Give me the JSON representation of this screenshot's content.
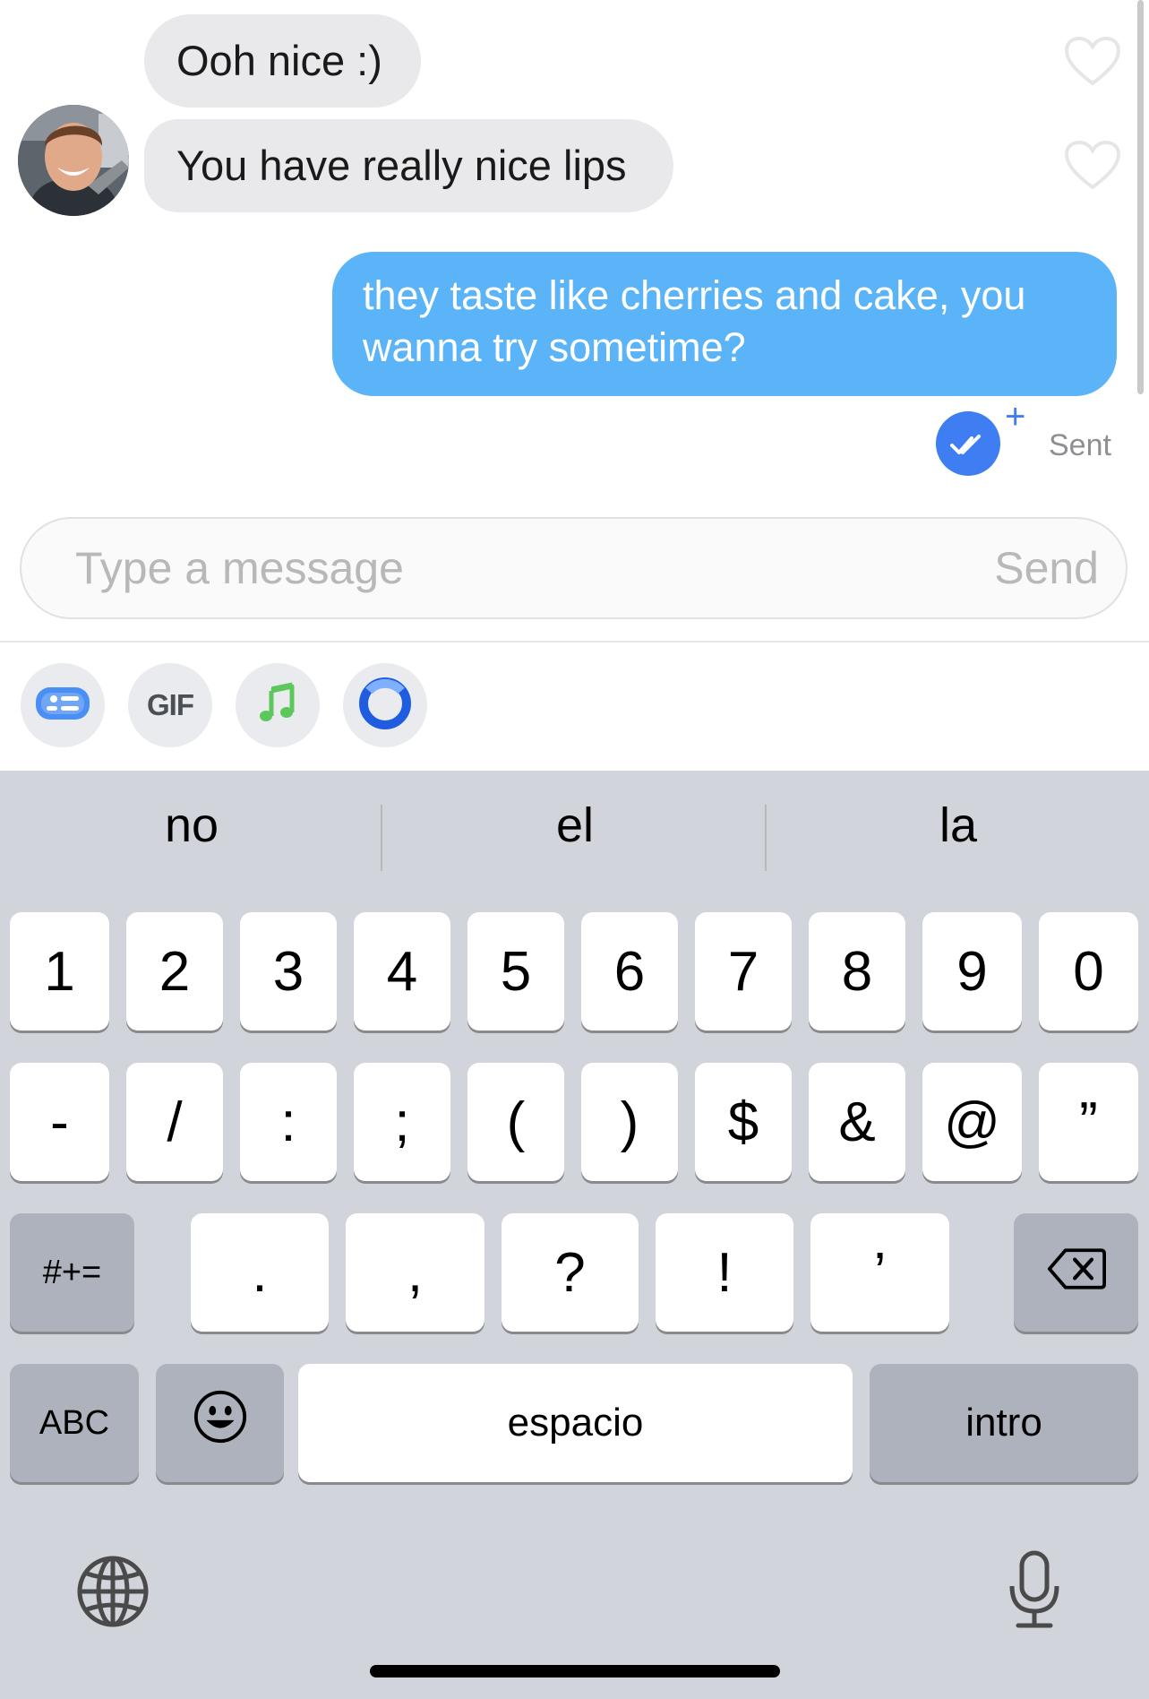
{
  "messages": [
    {
      "sender": "them",
      "text": "Ooh nice :)"
    },
    {
      "sender": "them",
      "text": "You have really nice lips"
    },
    {
      "sender": "me",
      "text": "they taste like cherries and cake, you wanna try sometime?"
    }
  ],
  "status": {
    "label": "Sent",
    "icon": "double-check-icon",
    "plus": "+"
  },
  "composer": {
    "placeholder": "Type a message",
    "send_label": "Send"
  },
  "toolbar": {
    "items": [
      {
        "name": "sticker-card-icon"
      },
      {
        "name": "gif-button",
        "label": "GIF"
      },
      {
        "name": "music-note-icon"
      },
      {
        "name": "ring-icon"
      }
    ]
  },
  "keyboard": {
    "suggestions": [
      "no",
      "el",
      "la"
    ],
    "row1": [
      "1",
      "2",
      "3",
      "4",
      "5",
      "6",
      "7",
      "8",
      "9",
      "0"
    ],
    "row2": [
      "-",
      "/",
      ":",
      ";",
      "(",
      ")",
      "$",
      "&",
      "@",
      "”"
    ],
    "row3": [
      ".",
      ",",
      "?",
      "!",
      "’"
    ],
    "symbols_label": "#+=",
    "abc_label": "ABC",
    "space_label": "espacio",
    "return_label": "intro"
  },
  "colors": {
    "outgoing_bubble": "#5ab4f7",
    "incoming_bubble": "#e9e9eb",
    "accent": "#3f7ef2",
    "keyboard_bg": "#d1d4da"
  }
}
